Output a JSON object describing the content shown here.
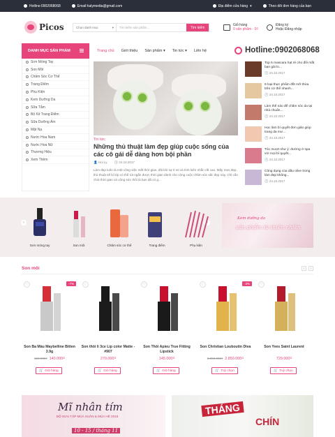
{
  "topbar": {
    "hotline": "Hotline:0902068068",
    "email": "Email:halymedia@gmail.com",
    "stores": "Địa điểm cửa hàng",
    "track": "Theo dõi đơn hàng của bạn"
  },
  "header": {
    "logo": "Picos",
    "category_select": "Chọn danh mục",
    "search_placeholder": "Tìm kiếm sản phẩm...",
    "search_button": "Tìm kiếm",
    "cart_label": "Giỏ hàng",
    "cart_price": "0 sản phẩm - 0₫",
    "account_label": "Đăng ký",
    "login_label": "Hoặc Đăng nhập"
  },
  "nav": {
    "category_title": "DANH MỤC SẢN PHẨM",
    "menu": [
      "Trang chủ",
      "Giới thiệu",
      "Sản phẩm ▾",
      "Tin tức ▾",
      "Liên hệ"
    ],
    "hotline": "Hotline:0902068068"
  },
  "sidebar": {
    "items": [
      "Sơn Móng Tay",
      "Son Môi",
      "Chăm Sóc Cơ Thể",
      "Trang Điểm",
      "Phụ Kiện",
      "Kem Dưỡng Da",
      "Sữa Tắm",
      "Bộ Kit Trang Điểm",
      "Sữa Dưỡng Ẩm",
      "Mặt Nạ",
      "Nước Hoa Nam",
      "Nước Hoa Nữ",
      "Thương Hiệu",
      "Xem Thêm"
    ]
  },
  "featured": {
    "tag": "Tin tức",
    "title": "Những thủ thuật làm đẹp giúp cuộc sống của các cô gái dễ dàng hơn bội phần",
    "author": "Hoi Ly",
    "date": "24.10.2017",
    "desc": "Làm đẹp luôn là một công việc mất thời gian, đôi khi sự tỉ mỉ và tính kiên nhẫn rất cao. Mấy mẹo đẹp, thủ thuật sẽ bí kíp có thể rút ngắn được thời gian dành cho công cuộc chăm sóc sắc đẹp này. Chỉ cần chút thời gian và công sức thôi là bạn đã có g..."
  },
  "news": [
    {
      "title": "Top 5 mascara hạt rẻ cho đôi mắt bạn gái lo...",
      "date": "24.10.2017"
    },
    {
      "title": "9 loại thực phẩm đốt mỡ thừa trên cơ thể nhanh...",
      "date": "24.10.2017"
    },
    {
      "title": "Làm thế nào để chăm sóc da tại nhà chuẩn...",
      "date": "24.10.2017"
    },
    {
      "title": "Học làm bí quyết đơn giản giúp trang da mư...",
      "date": "24.10.2017"
    },
    {
      "title": "Tóc mượt như ý: đường ở spa với mọi bí quyết...",
      "date": "24.10.2017"
    },
    {
      "title": "Công dụng của dầu olive trong làm đẹp không...",
      "date": "24.10.2017"
    }
  ],
  "categories": [
    {
      "label": "Sơn móng tay"
    },
    {
      "label": "Son môi"
    },
    {
      "label": "Chăm sóc cơ thể"
    },
    {
      "label": "Trang điểm"
    },
    {
      "label": "Phụ kiện"
    }
  ],
  "banner1": {
    "line1": "Kem dưỡng da",
    "line2": "sản phẩm từ thiên nhiên"
  },
  "section": {
    "title": "Son môi",
    "prev": "‹",
    "next": "›"
  },
  "products": [
    {
      "name": "Son Ba Màu Maybelline Bitten 3.9g",
      "old_price": "160.000₫",
      "price": "140.000₫",
      "button": "Giỏ hàng",
      "sale": "-7%"
    },
    {
      "name": "Son thỏi li 3ce Lip color Matte - #907",
      "old_price": "",
      "price": "270.000₫",
      "button": "Giỏ hàng",
      "sale": ""
    },
    {
      "name": "Son Thỏi Apieu True Fitting Lipstick",
      "old_price": "",
      "price": "145.000₫",
      "button": "Giỏ hàng",
      "sale": ""
    },
    {
      "name": "Son Christian Louboutin Diva",
      "old_price": "2.950.000₫",
      "price": "2.850.000₫",
      "button": "Tuỳ chọn",
      "sale": "-3%"
    },
    {
      "name": "Son Yves Saint Laurent",
      "old_price": "",
      "price": "729.000₫",
      "button": "Tuỳ chọn",
      "sale": ""
    }
  ],
  "banner2": {
    "title": "Mĩ nhân tím",
    "sub": "BỘ SƯU TẬP MÙA XUÂN & MÙA HÈ 2018",
    "date": "10 - 15 / tháng 11"
  },
  "banner3": {
    "a": "THÁNG",
    "b": "CHÍN"
  }
}
